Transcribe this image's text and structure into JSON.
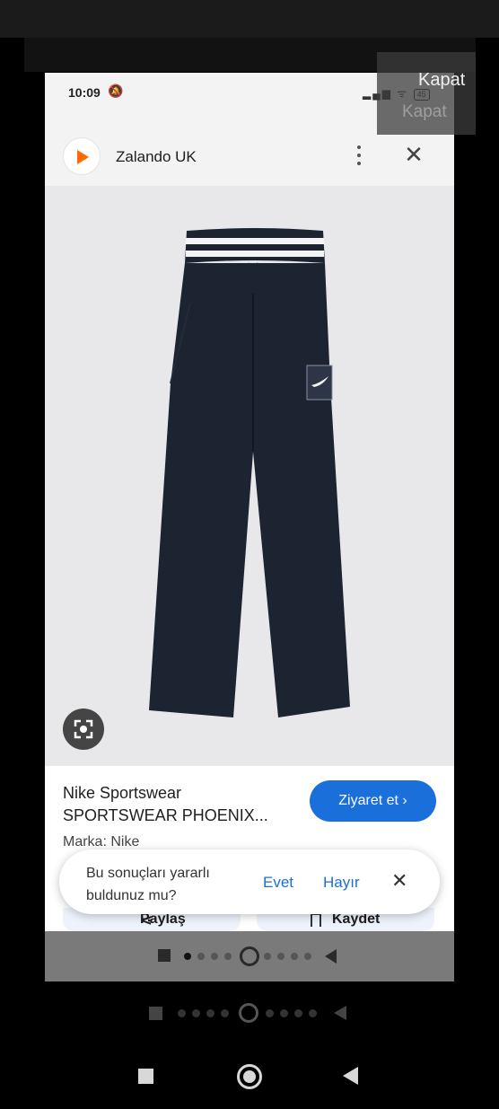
{
  "overlay": {
    "close_label": "Kapat",
    "close_ghost_label": "Kapat"
  },
  "status_bar": {
    "time": "10:09",
    "battery": "45"
  },
  "site": {
    "name": "Zalando UK",
    "logo_color": "#ff6900"
  },
  "product": {
    "brand_title": "Nike Sportswear",
    "name": "SPORTSWEAR PHOENIX...",
    "brand_line": "Marka: Nike",
    "visit_label": "Ziyaret et ›",
    "image_icon": "pants-image",
    "lens_icon": "lens-icon"
  },
  "feedback": {
    "question": "Bu sonuçları yararlı buldunuz mu?",
    "yes_label": "Evet",
    "no_label": "Hayır",
    "close_icon": "close-icon"
  },
  "actions": {
    "share_label": "Paylaş",
    "save_label": "Kaydet"
  },
  "colors": {
    "accent": "#1a6fdb",
    "pants": "#1c2331"
  }
}
